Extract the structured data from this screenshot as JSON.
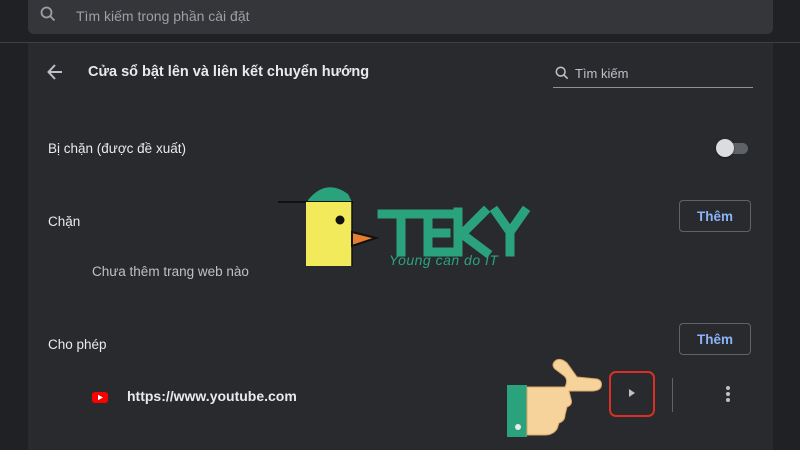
{
  "top_search": {
    "placeholder": "Tìm kiếm trong phần cài đặt"
  },
  "page": {
    "title": "Cửa sổ bật lên và liên kết chuyển hướng",
    "search_placeholder": "Tìm kiếm"
  },
  "blocked_recommended": {
    "label": "Bị chặn (được đề xuất)",
    "toggle_on": false
  },
  "block_section": {
    "label": "Chặn",
    "add_button": "Thêm",
    "empty_text": "Chưa thêm trang web nào"
  },
  "allow_section": {
    "label": "Cho phép",
    "add_button": "Thêm",
    "sites": [
      {
        "url": "https://www.youtube.com",
        "icon": "youtube-icon"
      }
    ]
  },
  "watermark": {
    "logo_text": "TEKY",
    "tagline": "Young can do IT"
  },
  "colors": {
    "background": "#202124",
    "card": "#292a2d",
    "accent_blue": "#8ab4f8",
    "highlight_red": "#d93025",
    "youtube_red": "#ff0000",
    "teky_green": "#2aa37c",
    "teky_yellow": "#f2ea5a"
  }
}
